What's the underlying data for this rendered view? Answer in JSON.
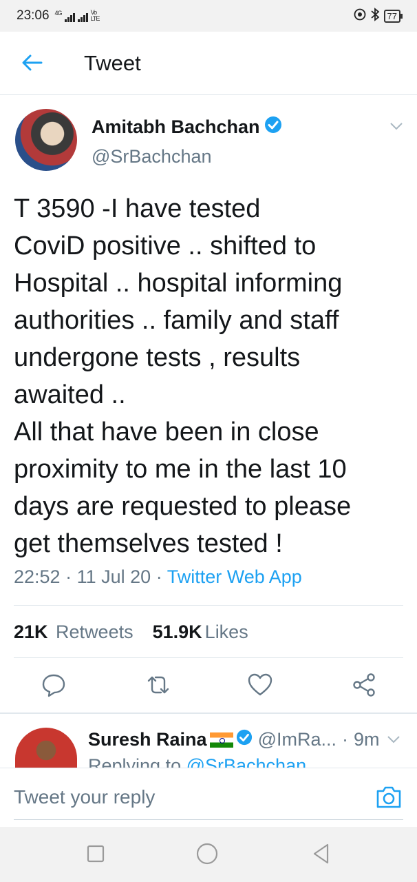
{
  "status_bar": {
    "time": "23:06",
    "network_label": "4G",
    "volte_label": "Vo LTE",
    "battery": "77"
  },
  "header": {
    "title": "Tweet"
  },
  "tweet": {
    "author_name": "Amitabh Bachchan",
    "handle": "@SrBachchan",
    "text": "T 3590 -I have tested\nCoviD positive ..  shifted to\nHospital  .. hospital informing\nauthorities .. family and staff\nundergone tests , results\nawaited ..\nAll that have been in close\nproximity to me in the last 10\ndays are requested to please\nget themselves tested !",
    "time": "22:52",
    "date": "11 Jul 20",
    "source": "Twitter Web App",
    "retweets_count": "21K",
    "retweets_label": "Retweets",
    "likes_count": "51.9K",
    "likes_label": "Likes"
  },
  "reply_preview": {
    "author_name": "Suresh Raina",
    "handle": "@ImRa...",
    "age": "9m",
    "replying_prefix": "Replying to",
    "replying_to": "@SrBachchan"
  },
  "composer": {
    "placeholder": "Tweet your reply"
  },
  "colors": {
    "accent": "#1da1f2",
    "secondary_text": "#657786",
    "primary_text": "#14171a",
    "divider": "#e1e8ed"
  },
  "icons": {
    "back": "back-arrow-icon",
    "verified": "verified-badge-icon",
    "more": "chevron-down-icon",
    "reply": "reply-icon",
    "retweet": "retweet-icon",
    "like": "heart-icon",
    "share": "share-icon",
    "camera": "camera-icon"
  }
}
